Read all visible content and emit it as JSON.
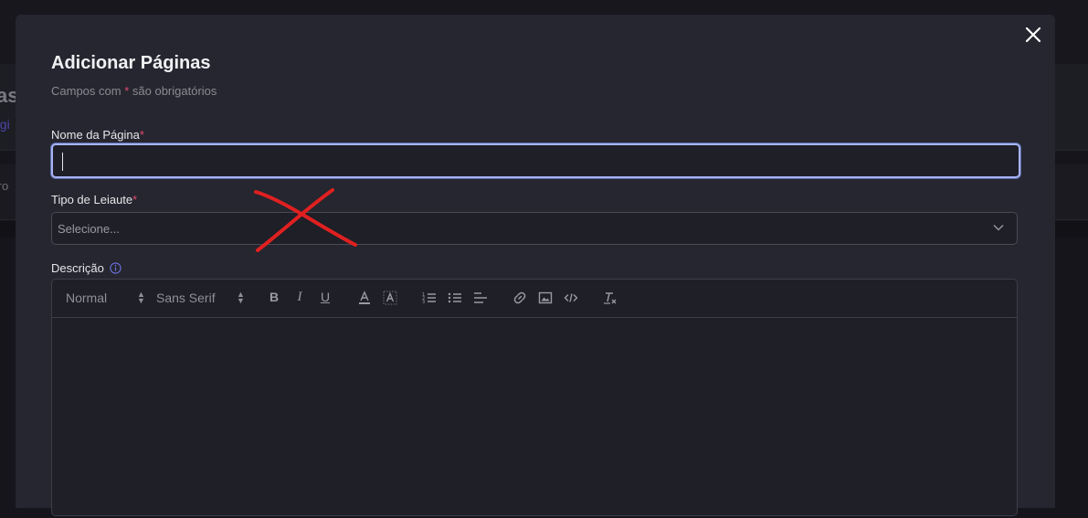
{
  "background": {
    "title": "as",
    "link": "ági",
    "filter_label": "tro"
  },
  "modal": {
    "title": "Adicionar Páginas",
    "subtitle_prefix": "Campos com",
    "subtitle_star": "*",
    "subtitle_suffix": "são obrigatórios",
    "close_icon": "close-icon"
  },
  "form": {
    "name_label": "Nome da Página",
    "name_value": "",
    "layout_label": "Tipo de Leiaute",
    "layout_placeholder": "Selecione...",
    "description_label": "Descrição",
    "required_mark": "*"
  },
  "editor": {
    "format_select": "Normal",
    "font_select": "Sans Serif",
    "toolbar_icons": [
      "bold-icon",
      "italic-icon",
      "underline-icon",
      "text-color-icon",
      "background-color-icon",
      "ordered-list-icon",
      "bullet-list-icon",
      "align-icon",
      "link-icon",
      "image-icon",
      "code-icon",
      "clear-format-icon"
    ],
    "content": ""
  },
  "colors": {
    "modal_bg": "#25262f",
    "focus_border": "#a7b3f2",
    "required": "#e24a6c",
    "annotation": "#e02020"
  }
}
